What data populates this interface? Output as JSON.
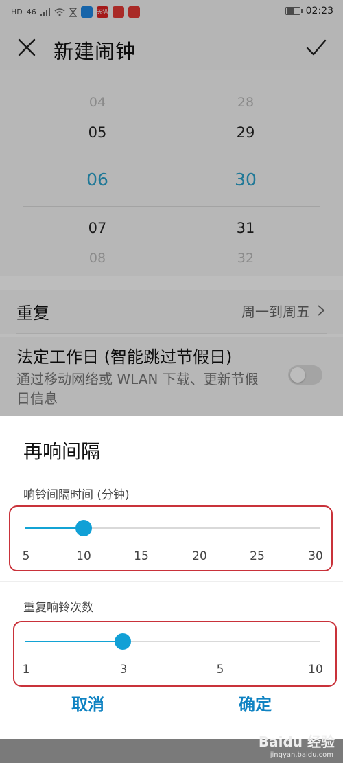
{
  "statusbar": {
    "network": "HD",
    "signal": "46",
    "tmall": "天猫",
    "time": "02:23",
    "battery_level": 0.6
  },
  "header": {
    "title": "新建闹钟"
  },
  "picker": {
    "hours": [
      "04",
      "05",
      "06",
      "07",
      "08"
    ],
    "minutes": [
      "28",
      "29",
      "30",
      "31",
      "32"
    ],
    "accent": "#2aa2cc"
  },
  "repeat": {
    "label": "重复",
    "value": "周一到周五"
  },
  "holiday": {
    "title": "法定工作日 (智能跳过节假日)",
    "subtitle": "通过移动网络或 WLAN 下载、更新节假日信息",
    "enabled": false
  },
  "dialog": {
    "title": "再响间隔",
    "interval": {
      "label": "响铃间隔时间 (分钟)",
      "ticks": [
        "5",
        "10",
        "15",
        "20",
        "25",
        "30"
      ],
      "value": 10,
      "min": 5,
      "max": 30
    },
    "repeats": {
      "label": "重复响铃次数",
      "ticks": [
        "1",
        "3",
        "5",
        "10"
      ],
      "value": 3
    },
    "cancel": "取消",
    "confirm": "确定"
  },
  "watermark": {
    "brand": "Baidu 经验",
    "url": "jingyan.baidu.com"
  },
  "colors": {
    "accent": "#13a3d4",
    "button": "#0e82c2",
    "highlight": "#c9323a"
  }
}
